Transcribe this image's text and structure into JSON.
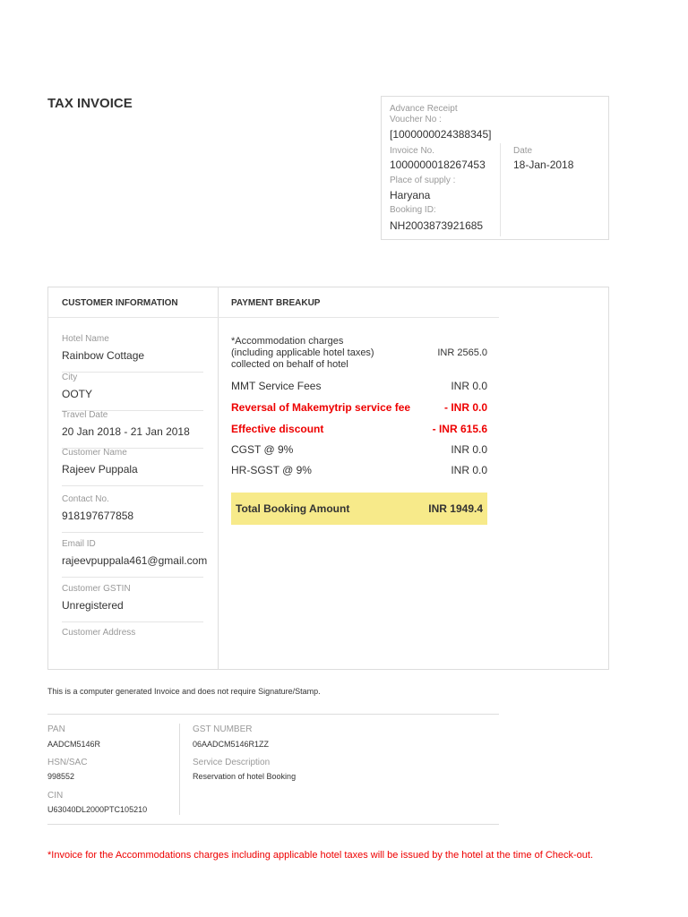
{
  "title": "TAX INVOICE",
  "receipt": {
    "voucher_label": "Advance Receipt Voucher No :",
    "voucher": "[1000000024388345]",
    "invoice_label": "Invoice No.",
    "invoice": "1000000018267453",
    "date_label": "Date",
    "date": "18-Jan-2018",
    "supply_label": "Place of supply :",
    "supply": "Haryana",
    "booking_label": "Booking ID:",
    "booking": "NH2003873921685"
  },
  "customer": {
    "header": "CUSTOMER INFORMATION",
    "fields": [
      {
        "label": "Hotel Name",
        "value": "Rainbow Cottage"
      },
      {
        "label": "City",
        "value": "OOTY"
      },
      {
        "label": "Travel Date",
        "value": "20 Jan 2018 - 21 Jan 2018"
      },
      {
        "label": "Customer Name",
        "value": "Rajeev Puppala"
      },
      {
        "label": "Contact No.",
        "value": "918197677858"
      },
      {
        "label": "Email ID",
        "value": "rajeevpuppala461@gmail.com"
      },
      {
        "label": "Customer GSTIN",
        "value": "Unregistered"
      },
      {
        "label": "Customer Address",
        "value": ""
      }
    ]
  },
  "payment": {
    "header": "PAYMENT BREAKUP",
    "accommodation_label": "*Accommodation charges\n(including applicable hotel taxes)\ncollected on behalf of hotel",
    "accommodation": "INR 2565.0",
    "rows": [
      {
        "label": "MMT Service Fees",
        "value": "INR 0.0"
      },
      {
        "label": "Reversal of Makemytrip service fee",
        "value": "- INR 0.0"
      },
      {
        "label": "Effective discount",
        "value": "- INR 615.6"
      },
      {
        "label": "CGST @ 9%",
        "value": "INR 0.0"
      },
      {
        "label": "HR-SGST @ 9%",
        "value": "INR 0.0"
      }
    ],
    "total_label": "Total Booking Amount",
    "total": "INR 1949.4"
  },
  "note": "This is a computer generated Invoice and does not require Signature/Stamp.",
  "footer": {
    "pan_label": "PAN",
    "pan": "AADCM5146R",
    "hsn_label": "HSN/SAC",
    "hsn": "998552",
    "cin_label": "CIN",
    "cin": "U63040DL2000PTC105210",
    "gst_label": "GST NUMBER",
    "gst": "06AADCM5146R1ZZ",
    "service_label": "Service Description",
    "service": "Reservation of hotel Booking"
  },
  "footnote": "*Invoice for the Accommodations charges including applicable hotel taxes will be issued by the hotel at the time of Check-out.",
  "colors": {
    "highlight": "#f7ea8a",
    "red": "#ee0000"
  }
}
